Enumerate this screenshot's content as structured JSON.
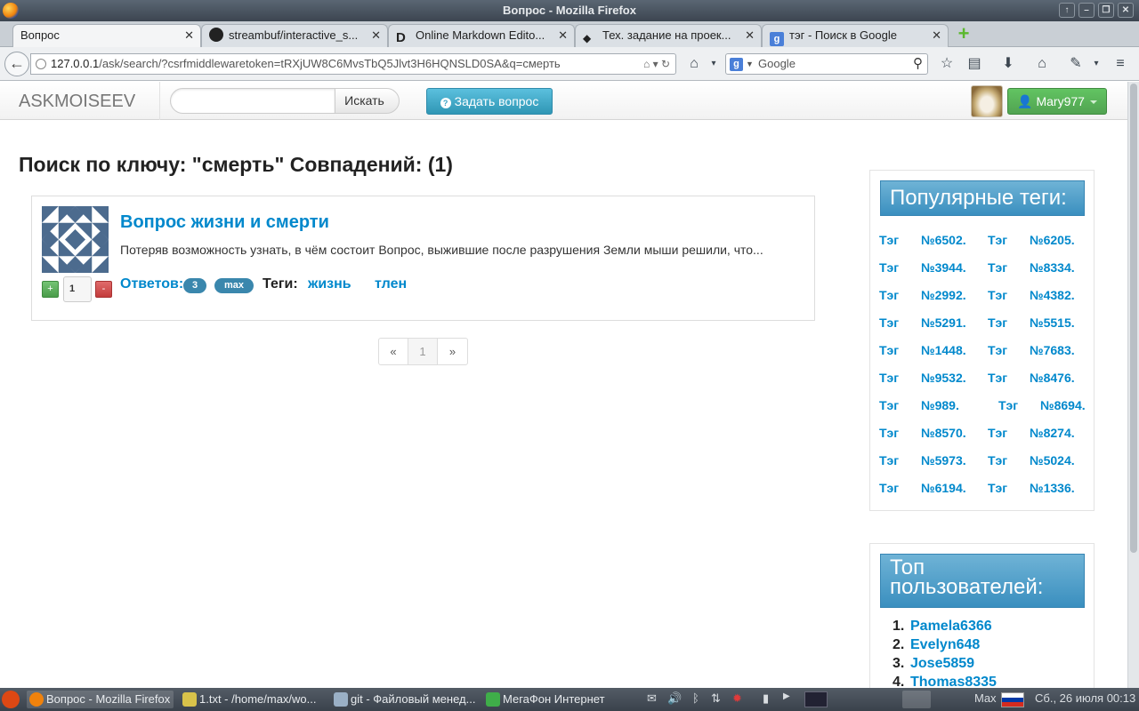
{
  "window": {
    "title": "Вопрос - Mozilla Firefox"
  },
  "tabs": [
    {
      "label": "Вопрос",
      "active": true
    },
    {
      "label": "streambuf/interactive_s..."
    },
    {
      "label": "Online Markdown Edito..."
    },
    {
      "label": "Тех. задание на проек..."
    },
    {
      "label": "тэг - Поиск в Google"
    }
  ],
  "navbar": {
    "url_host": "127.0.0.1",
    "url_path": "/ask/search/?csrfmiddlewaretoken=tRXjUW8C6MvsTbQ5Jlvt3H6HQNSLD0SA&q=смерть",
    "search_placeholder": "Google"
  },
  "app": {
    "brand": "ASKMOISEEV",
    "search_button": "Искать",
    "search_value": "",
    "ask_button": "Задать вопрос",
    "user_button": "Mary977"
  },
  "main": {
    "heading": "Поиск по ключу: \"смерть\" Совпадений: (1)",
    "result": {
      "title": "Вопрос жизни и смерти",
      "excerpt": "Потеряв возможность узнать, в чём состоит Вопрос, выжившие после разрушения Земли мыши решили, что...",
      "vote_plus": "+",
      "vote_value": "1",
      "vote_minus": "-",
      "answers_label": "Ответов:",
      "answers_count": "3",
      "author": "max",
      "tags_label": "Теги:",
      "tags": [
        "жизнь",
        "тлен"
      ]
    },
    "pager": {
      "prev": "«",
      "current": "1",
      "next": "»"
    }
  },
  "sidebar": {
    "popular_tags_title": "Популярные теги:",
    "popular_tags": [
      [
        "Тэг",
        "№6502.",
        "Тэг",
        "№6205."
      ],
      [
        "Тэг",
        "№3944.",
        "Тэг",
        "№8334."
      ],
      [
        "Тэг",
        "№2992.",
        "Тэг",
        "№4382."
      ],
      [
        "Тэг",
        "№5291.",
        "Тэг",
        "№5515."
      ],
      [
        "Тэг",
        "№1448.",
        "Тэг",
        "№7683."
      ],
      [
        "Тэг",
        "№9532.",
        "Тэг",
        "№8476."
      ],
      [
        "Тэг",
        "№989.",
        "Тэг",
        "№8694."
      ],
      [
        "Тэг",
        "№8570.",
        "Тэг",
        "№8274."
      ],
      [
        "Тэг",
        "№5973.",
        "Тэг",
        "№5024."
      ],
      [
        "Тэг",
        "№6194.",
        "Тэг",
        "№1336."
      ]
    ],
    "top_users_title_line1": "Топ",
    "top_users_title_line2": "пользователей:",
    "top_users": [
      {
        "num": "1.",
        "name": "Pamela6366"
      },
      {
        "num": "2.",
        "name": "Evelyn648"
      },
      {
        "num": "3.",
        "name": "Jose5859"
      },
      {
        "num": "4.",
        "name": "Thomas8335"
      }
    ]
  },
  "taskbar": {
    "tasks": [
      "Вопрос - Mozilla Firefox",
      "1.txt - /home/max/wo...",
      "git - Файловый менед...",
      "МегаФон Интернет"
    ],
    "user": "Max",
    "clock": "Сб., 26 июля  00:13"
  },
  "colors": {
    "link": "#0088cc",
    "info_button": "#49afcd",
    "success_button": "#5bb75b",
    "badge": "#3a87ad"
  }
}
